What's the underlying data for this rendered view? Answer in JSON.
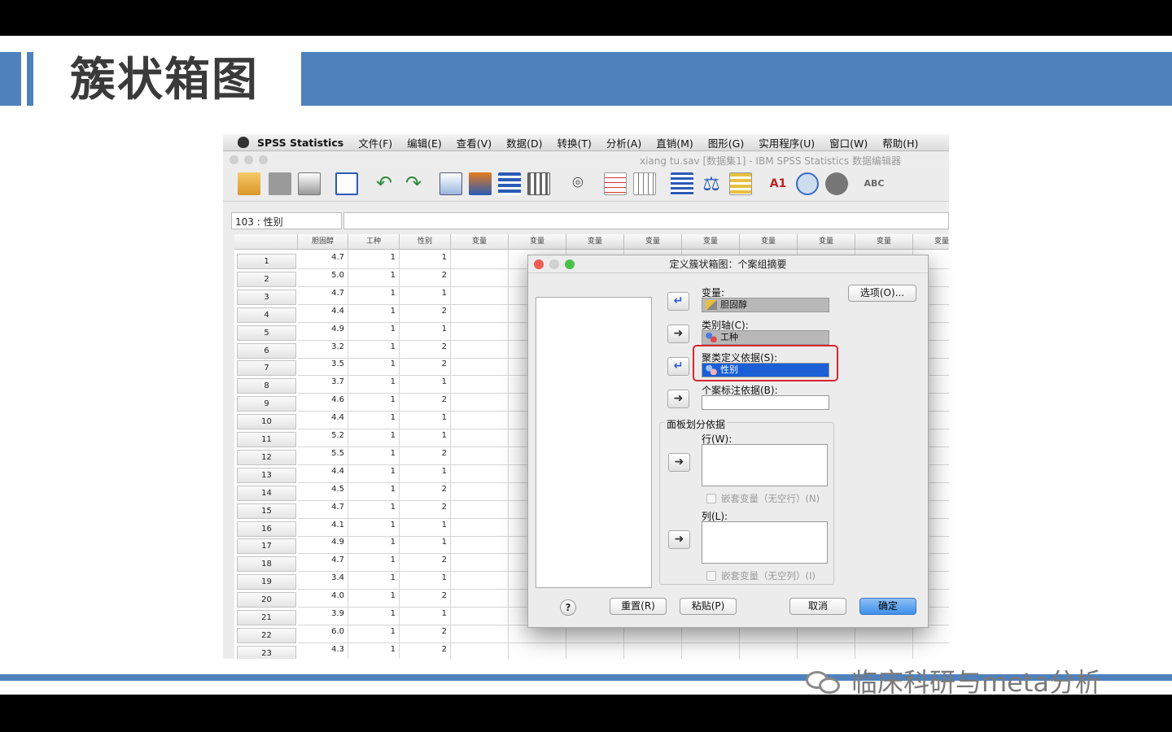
{
  "slide": {
    "title": "簇状箱图",
    "footer_text": "临床科研与meta分析"
  },
  "menubar": {
    "app_name": "SPSS Statistics",
    "items": [
      "文件(F)",
      "编辑(E)",
      "查看(V)",
      "数据(D)",
      "转换(T)",
      "分析(A)",
      "直销(M)",
      "图形(G)",
      "实用程序(U)",
      "窗口(W)",
      "帮助(H)"
    ]
  },
  "window": {
    "title": "xiang tu.sav [数据集1] - IBM SPSS Statistics 数据编辑器"
  },
  "toolbar": {
    "icons": [
      "open-icon",
      "save-icon",
      "print-icon",
      "dialog-recall-icon",
      "undo-icon",
      "redo-icon",
      "goto-case-icon",
      "goto-variable-icon",
      "variables-icon",
      "run-icon",
      "find-icon",
      "insert-cases-icon",
      "insert-variable-icon",
      "split-file-icon",
      "weight-cases-icon",
      "select-cases-icon",
      "value-labels-icon",
      "use-sets-icon",
      "show-sets-icon",
      "spell-check-icon"
    ]
  },
  "cell_editor": {
    "ref": "103 : 性别",
    "value": ""
  },
  "grid": {
    "columns": [
      "胆固醇",
      "工种",
      "性别",
      "变量",
      "变量",
      "变量",
      "变量",
      "变量",
      "变量",
      "变量",
      "变量",
      "变量"
    ],
    "rows": [
      [
        "1",
        "4.7",
        "1",
        "1"
      ],
      [
        "2",
        "5.0",
        "1",
        "2"
      ],
      [
        "3",
        "4.7",
        "1",
        "1"
      ],
      [
        "4",
        "4.4",
        "1",
        "2"
      ],
      [
        "5",
        "4.9",
        "1",
        "1"
      ],
      [
        "6",
        "3.2",
        "1",
        "2"
      ],
      [
        "7",
        "3.5",
        "1",
        "2"
      ],
      [
        "8",
        "3.7",
        "1",
        "1"
      ],
      [
        "9",
        "4.6",
        "1",
        "2"
      ],
      [
        "10",
        "4.4",
        "1",
        "1"
      ],
      [
        "11",
        "5.2",
        "1",
        "1"
      ],
      [
        "12",
        "5.5",
        "1",
        "2"
      ],
      [
        "13",
        "4.4",
        "1",
        "1"
      ],
      [
        "14",
        "4.5",
        "1",
        "2"
      ],
      [
        "15",
        "4.7",
        "1",
        "2"
      ],
      [
        "16",
        "4.1",
        "1",
        "1"
      ],
      [
        "17",
        "4.9",
        "1",
        "1"
      ],
      [
        "18",
        "4.7",
        "1",
        "2"
      ],
      [
        "19",
        "3.4",
        "1",
        "1"
      ],
      [
        "20",
        "4.0",
        "1",
        "2"
      ],
      [
        "21",
        "3.9",
        "1",
        "1"
      ],
      [
        "22",
        "6.0",
        "1",
        "2"
      ],
      [
        "23",
        "4.3",
        "1",
        "2"
      ]
    ]
  },
  "dialog": {
    "title": "定义簇状箱图：个案组摘要",
    "options_button": "选项(O)...",
    "variable_label": "变量:",
    "variable_value": "胆固醇",
    "category_label": "类别轴(C):",
    "category_value": "工种",
    "cluster_label": "聚类定义依据(S):",
    "cluster_value": "性别",
    "case_label": "个案标注依据(B):",
    "case_value": "",
    "panel_label": "面板划分依据",
    "rows_label": "行(W):",
    "rows_nest": "嵌套变量（无空行）(N)",
    "cols_label": "列(L):",
    "cols_nest": "嵌套变量（无空列）(I)",
    "help": "?",
    "reset": "重置(R)",
    "paste": "粘贴(P)",
    "cancel": "取消",
    "ok": "确定"
  },
  "colors": {
    "accent": "#4f81bd",
    "highlight": "#d9262f",
    "selection": "#1a5fd6"
  }
}
